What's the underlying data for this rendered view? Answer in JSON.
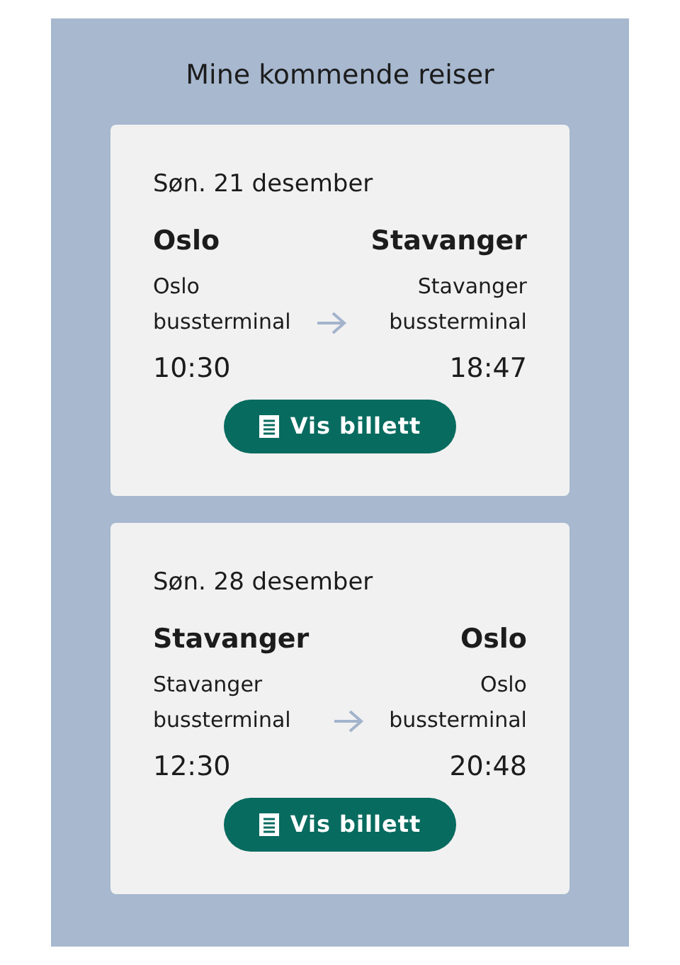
{
  "title": "Mine kommende reiser",
  "trips": [
    {
      "date": "Søn. 21 desember",
      "from": {
        "city": "Oslo",
        "station": [
          "Oslo",
          "bussterminal"
        ],
        "time": "10:30"
      },
      "to": {
        "city": "Stavanger",
        "station": [
          "Stavanger",
          "bussterminal"
        ],
        "time": "18:47"
      },
      "button": "Vis billett"
    },
    {
      "date": "Søn. 28 desember",
      "from": {
        "city": "Stavanger",
        "station": [
          "Stavanger",
          "bussterminal"
        ],
        "time": "12:30"
      },
      "to": {
        "city": "Oslo",
        "station": [
          "Oslo",
          "bussterminal"
        ],
        "time": "20:48"
      },
      "button": "Vis billett"
    }
  ]
}
